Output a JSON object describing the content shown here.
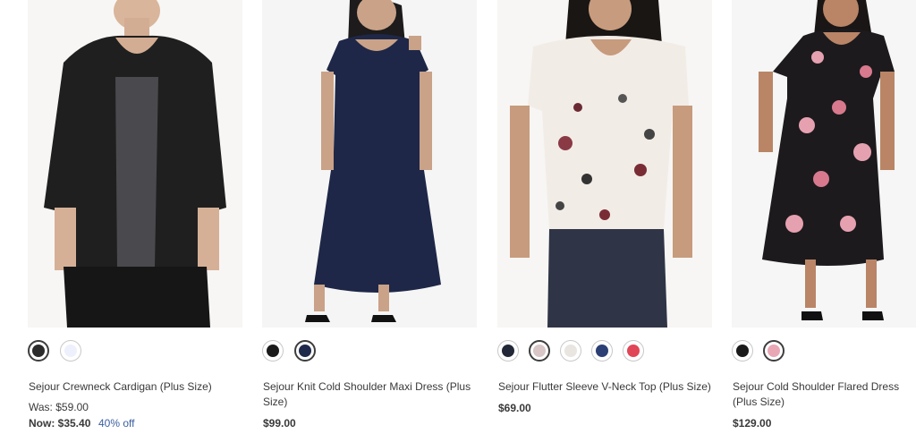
{
  "products": [
    {
      "name": "Sejour Crewneck Cardigan (Plus Size)",
      "was_price": "Was: $59.00",
      "now_price": "Now: $35.40",
      "discount": "40% off",
      "swatches": [
        {
          "color": "#2b2b2b",
          "name": "black",
          "selected": true
        },
        {
          "color": "#eef1fb",
          "name": "white",
          "selected": false
        }
      ]
    },
    {
      "name": "Sejour Knit Cold Shoulder Maxi Dress (Plus Size)",
      "price": "$99.00",
      "swatches": [
        {
          "color": "#1a1a1a",
          "name": "black",
          "selected": false
        },
        {
          "color": "#1f2a4b",
          "name": "navy",
          "selected": true
        }
      ]
    },
    {
      "name": "Sejour Flutter Sleeve V-Neck Top (Plus Size)",
      "price": "$69.00",
      "swatches": [
        {
          "color": "#232838",
          "name": "navy-dark",
          "selected": false
        },
        {
          "color": "#d9c6c6",
          "name": "floral-print",
          "selected": true
        },
        {
          "color": "#e9e5e0",
          "name": "ivory",
          "selected": false
        },
        {
          "color": "#2c3f74",
          "name": "blue",
          "selected": false
        },
        {
          "color": "#e04657",
          "name": "red",
          "selected": false
        }
      ]
    },
    {
      "name": "Sejour Cold Shoulder Flared Dress (Plus Size)",
      "price": "$129.00",
      "swatches": [
        {
          "color": "#1a1a1a",
          "name": "black",
          "selected": false
        },
        {
          "color": "#e9a7b5",
          "name": "pink-floral",
          "selected": true
        }
      ]
    }
  ]
}
